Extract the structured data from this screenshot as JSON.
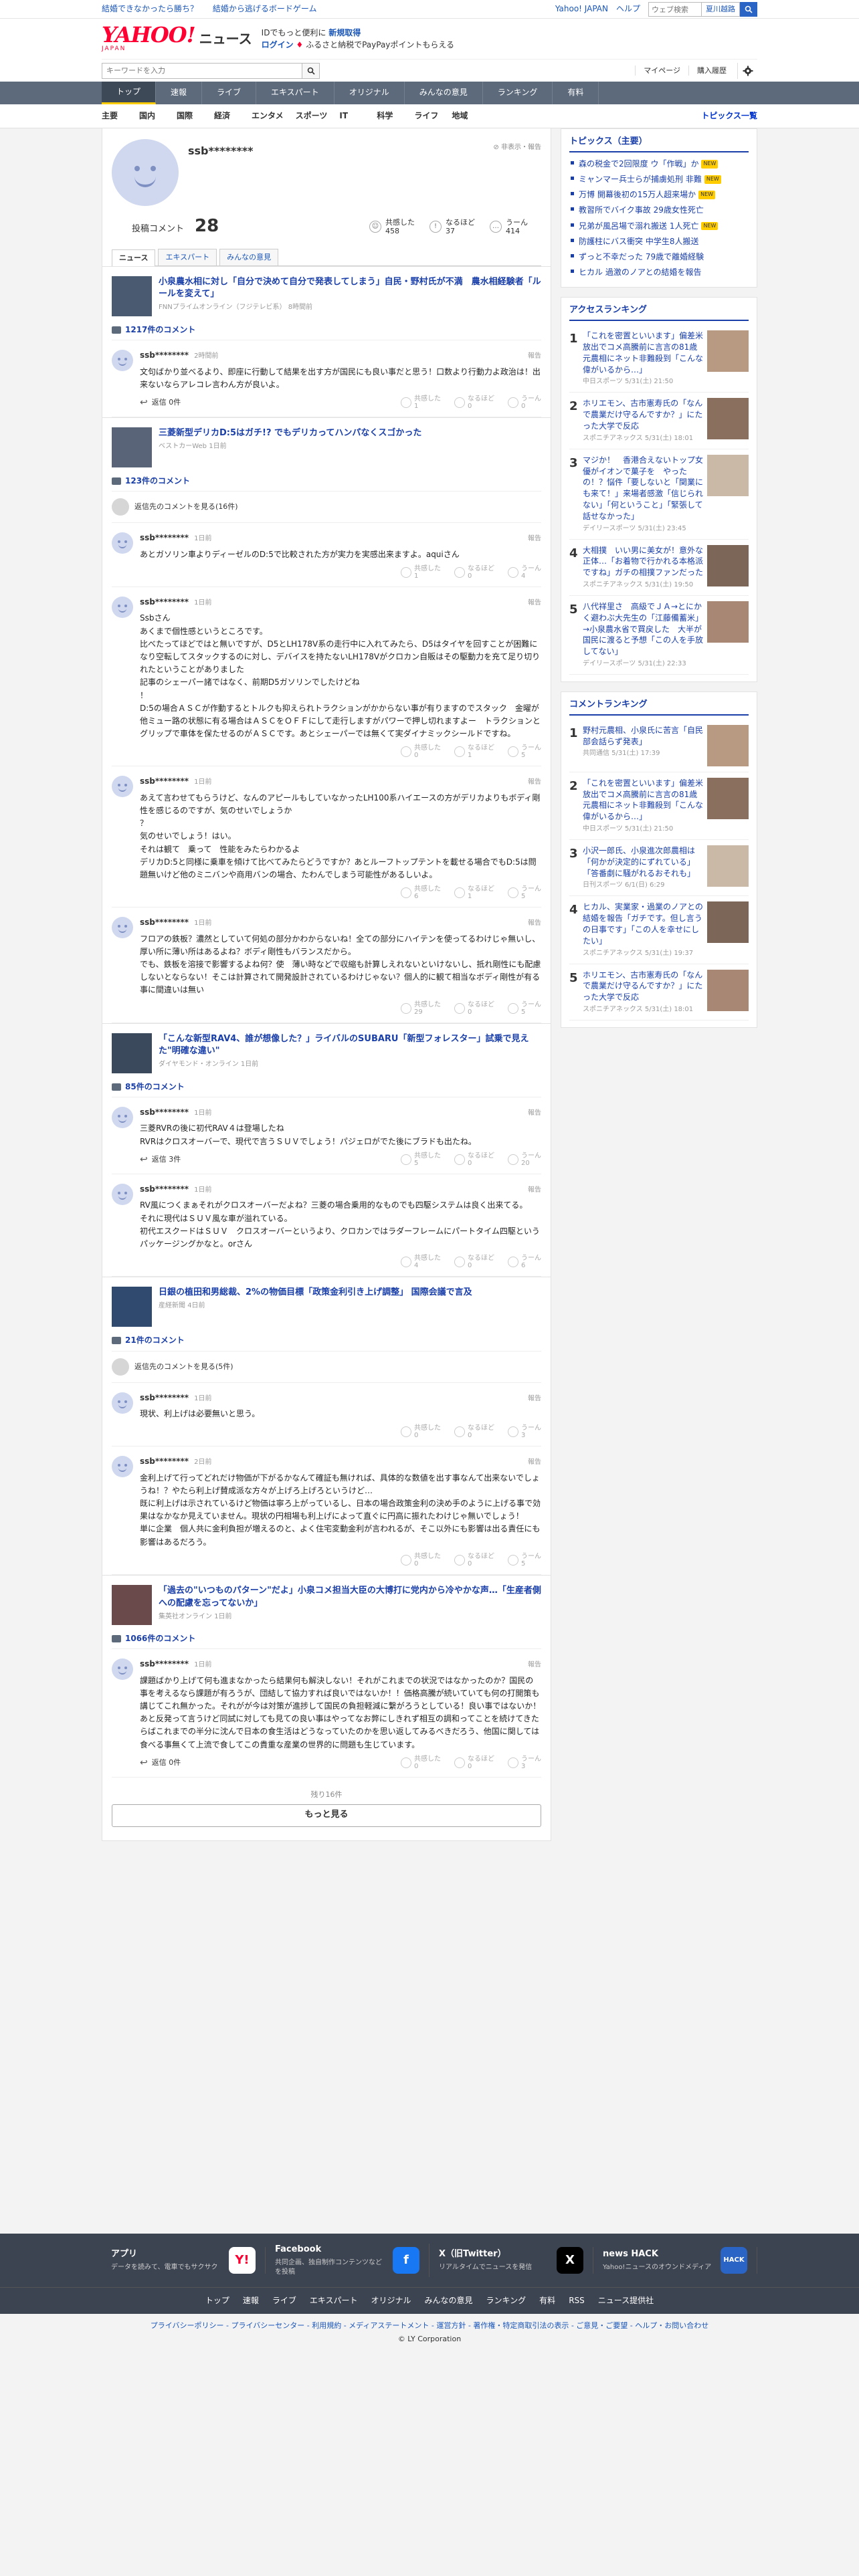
{
  "topbar": {
    "link1": "結婚できなかったら勝ち？",
    "link2": "結婚から逃げるボードゲーム",
    "yahoo_top": "Yahoo! JAPAN",
    "help": "ヘルプ",
    "search_placeholder": "ウェブ検索",
    "location": "夏川越路"
  },
  "header": {
    "logo_main": "YAHOO!",
    "logo_sub": "JAPAN",
    "logo_news": "ニュース",
    "msg1": "IDでもっと便利に",
    "msg1_bold": "新規取得",
    "msg2_login": "ログイン",
    "msg2": "ふるさと納税でPayPayポイントもらえる"
  },
  "search": {
    "placeholder": "キーワードを入力",
    "mypage": "マイページ",
    "purchase": "購入履歴"
  },
  "nav": {
    "items": [
      "トップ",
      "速報",
      "ライブ",
      "エキスパート",
      "オリジナル",
      "みんなの意見",
      "ランキング",
      "有料"
    ]
  },
  "subnav": {
    "items": [
      "主要",
      "国内",
      "国際",
      "経済",
      "エンタメ",
      "スポーツ",
      "IT",
      "科学",
      "ライフ",
      "地域"
    ],
    "all": "トピックス一覧"
  },
  "profile": {
    "name": "ssb********",
    "flag": "非表示・報告",
    "comments_label": "投稿コメント",
    "comments_count": "28",
    "reactions": [
      {
        "label": "共感した",
        "count": "458",
        "icon": "☺"
      },
      {
        "label": "なるほど",
        "count": "37",
        "icon": "!"
      },
      {
        "label": "うーん",
        "count": "414",
        "icon": "…"
      }
    ],
    "tabs": [
      "ニュース",
      "エキスパート",
      "みんなの意見"
    ]
  },
  "articles": [
    {
      "title": "小泉農水相に対し「自分で決めて自分で発表してしまう」自民・野村氏が不満　農水相経験者「ルールを変えて」",
      "source": "FNNプライムオンライン（フジテレビ系）",
      "time": "8時間前",
      "count": "1217件のコメント",
      "parent": "",
      "comments": [
        {
          "user": "ssb********",
          "time": "2時間前",
          "text": "文句ばかり並べるより、即座に行動して結果を出す方が国民にも良い事だと思う！口数より行動力よ政治は！出来ないならアレコレ言わん方が良いよ。",
          "reply": "返信 0件",
          "v": [
            "1",
            "0",
            "0"
          ]
        }
      ]
    },
    {
      "title": "三菱新型デリカD:5はガチ!? でもデリカってハンパなくスゴかった",
      "source": "ベストカーWeb",
      "time": "1日前",
      "count": "123件のコメント",
      "parent": "返信先のコメントを見る(16件)",
      "comments": [
        {
          "user": "ssb********",
          "time": "1日前",
          "text": "あとガソリン車よりディーゼルのD:5で比較された方が実力を実感出来ますよ。aquiさん",
          "reply": "",
          "v": [
            "1",
            "0",
            "4"
          ]
        },
        {
          "user": "ssb********",
          "time": "1日前",
          "text": "Ssbさん\nあくまで個性感というところです。\n比べたってほどではと無いですが、D5とLH178V系の走行中に入れてみたら、D5はタイヤを回すことが困難になり空転してスタックするのに対し、デバイスを持たないLH178Vがクロカン自販はその駆動力を充て足り切りれたということがありました\n記事のシェーパー諸ではなく、前期D5ガソリンでしたけどね\n！\nD:5の場合ＡＳＣが作動するとトルクも抑えられトラクションがかからない事が有りますのでスタック　金曜が他ミュー路の状態に有る場合はＡＳＣをＯＦＦにして走行しますがパワーで押し切れますよー　トラクションとグリップで車体を保たせるのがＡＳＣです。あとシェーパーでは無くて実ダイナミックシールドですね。",
          "reply": "",
          "v": [
            "0",
            "1",
            "5"
          ]
        },
        {
          "user": "ssb********",
          "time": "1日前",
          "text": "あえて言わせてもらうけど、なんのアピールもしていなかったLH100系ハイエースの方がデリカよりもボディ剛性を感じるのですが、気のせいでしょうか\n？\n気のせいでしょう！はい。\nそれは観て　乗って　性能をみたらわかるよ\nデリカD:5と同様に乗車を傾けて比べてみたらどうですか？あとルーフトップテントを載せる場合でもD:5は問題無いけど他のミニバンや商用バンの場合、たわんでしまう可能性があるしいよ。",
          "reply": "",
          "v": [
            "6",
            "1",
            "5"
          ]
        },
        {
          "user": "ssb********",
          "time": "1日前",
          "text": "フロアの鉄板？濃然としていて何処の部分かわからないね！全ての部分にハイテンを使ってるわけじゃ無いし、厚い所に薄い所はあるよね？ボディ剛性もバランスだから。\nでも、鉄板を溶接で影響するよね何？使　薄い時などで収縮も計算しえれないといけないし、抵れ剛性にも配慮しないとならない！そこは計算されて開発設計されているわけじゃない？個人的に観て相当なボディ剛性が有る事に間違いは無い",
          "reply": "",
          "v": [
            "29",
            "0",
            "5"
          ]
        }
      ]
    },
    {
      "title": "「こんな新型RAV4、誰が想像した？」ライバルのSUBARU「新型フォレスター」試乗で見えた\"明確な違い\"",
      "source": "ダイヤモンド・オンライン",
      "time": "1日前",
      "count": "85件のコメント",
      "parent": "",
      "comments": [
        {
          "user": "ssb********",
          "time": "1日前",
          "text": "三菱RVRの後に初代RAV４は登場したね\nRVRはクロスオーバーで、現代で言うＳＵＶでしょう！パジェロがでた後にブラドも出たね。",
          "reply": "返信 3件",
          "v": [
            "5",
            "0",
            "20"
          ]
        },
        {
          "user": "ssb********",
          "time": "1日前",
          "text": "RV風につくまぁそれがクロスオーバーだよね？三菱の場合乗用的なものでも四駆システムは良く出来てる。\nそれに現代はＳＵＶ風な車が溢れている。\n初代エスクードはＳＵＶ　クロスオーバーというより、クロカンではラダーフレームにパートタイム四駆というパッケージングかなと。orさん",
          "reply": "",
          "v": [
            "4",
            "0",
            "6"
          ]
        }
      ]
    },
    {
      "title": "日銀の植田和男総裁、2%の物価目標「政策金利引き上げ調整」 国際会議で言及",
      "source": "産経新聞",
      "time": "4日前",
      "count": "21件のコメント",
      "parent": "返信先のコメントを見る(5件)",
      "comments": [
        {
          "user": "ssb********",
          "time": "1日前",
          "text": "現状、利上げは必要無いと思う。",
          "reply": "",
          "v": [
            "0",
            "0",
            "3"
          ]
        },
        {
          "user": "ssb********",
          "time": "2日前",
          "text": "金利上げて行ってどれだけ物価が下がるかなんて確証も無ければ、具体的な数値を出す事なんて出来ないでしょうね！？やたら利上げ賛成派な方々が上げろ上げろというけど…\n既に利上げは示されているけど物価は寧ろ上がっているし、日本の場合政策金利の決め手のように上げる事で効果はなかなか見えていません。現状の円相場も利上げによって直ぐに円高に振れたわけじゃ無いでしょう！\n単に企業　個人共に金利負担が増えるのと、よく住宅変動金利が言われるが、そこ以外にも影響は出る責任にも影響はあるだろう。",
          "reply": "",
          "v": [
            "0",
            "0",
            "5"
          ]
        }
      ]
    },
    {
      "title": "「過去の\"いつものパターン\"だよ」小泉コメ担当大臣の大博打に党内から冷やかな声…「生産者側への配慮を忘ってないか」",
      "source": "集英社オンライン",
      "time": "1日前",
      "count": "1066件のコメント",
      "parent": "",
      "comments": [
        {
          "user": "ssb********",
          "time": "1日前",
          "text": "課題ばかり上げて何も進まなかったら結果何も解決しない！それがこれまでの状況ではなかったのか？国民の事を考えるなら課題が有ろうが、団結して協力すれば良いではないか！！価格高騰が続いていても何の打開策も講じてこれ無かった。それがが今は対策が進捗して国民の負担軽減に繋がろうとしている！良い事ではないか！あと反発って言うけど同試に対しても見ての良い事はやってなお弊にしきれず相互の調和ってことを続けてきたらばこれまでの半分に沈んで日本の食生活はどうなっていたのかを思い返してみるべきだろう、他国に関しては食べる事無くて上流で食してこの貴重な産業の世界的に問題も生じています。",
          "reply": "返信 0件",
          "v": [
            "0",
            "0",
            "3"
          ]
        }
      ]
    }
  ],
  "more": {
    "remaining": "残り16件",
    "button": "もっと見る"
  },
  "right": {
    "topics_title": "トピックス（主要）",
    "topics": [
      {
        "text": "森の税金で2回限度 ウ「作戦」か",
        "badge": "NEW"
      },
      {
        "text": "ミャンマー兵士らが捕虜処刑 非難",
        "badge": "NEW"
      },
      {
        "text": "万博 開幕後初の15万人超来場か",
        "badge": "NEW"
      },
      {
        "text": "教習所でバイク事故 29歳女性死亡",
        "badge": ""
      },
      {
        "text": "兄弟が風呂場で溺れ搬送 1人死亡",
        "badge": "NEW"
      },
      {
        "text": "防護柱にバス衝突 中学生8人搬送",
        "badge": ""
      },
      {
        "text": "ずっと不幸だった 79歳で離婚経験",
        "badge": ""
      },
      {
        "text": "ヒカル 過激のノアとの結婚を報告",
        "badge": ""
      }
    ],
    "access_title": "アクセスランキング",
    "access": [
      {
        "n": "1",
        "text": "「これを密置といいます」偏差米放出でコメ高騰前に言言の81歳元農相にネット非難殺到「こんな偉がいるから…」",
        "src": "中日スポーツ 5/31(土) 21:50"
      },
      {
        "n": "2",
        "text": "ホリエモン、古市憲寿氏の「なんで農業だけ守るんですか？」にたった大学で反応",
        "src": "スポニチアネックス 5/31(土) 18:01"
      },
      {
        "n": "3",
        "text": "マジか！　香港合えないトップ女優がイオンで菓子を　やったの！？悩件「要しないと「関業にも来て！」来場者感激「信じられない」「何ということ」「緊張して話せなかった」",
        "src": "デイリースポーツ 5/31(土) 23:45"
      },
      {
        "n": "4",
        "text": "大相撲　いい男に美女が！意外な正体…「お着物で行かれる本格派ですね」ガチの相撲ファンだった",
        "src": "スポニチアネックス 5/31(土) 19:50"
      },
      {
        "n": "5",
        "text": "八代祥里さ　高級でＪＡ→とにかく避わぶ大先生の「江藤備蓄米」→小泉農水省で買戻した　大半が国民に渡ると予想「この人を手放してない」",
        "src": "デイリースポーツ 5/31(土) 22:33"
      }
    ],
    "comment_title": "コメントランキング",
    "comment": [
      {
        "n": "1",
        "text": "野村元農相、小泉氏に苦言「自民部会話らず発表」",
        "src": "共同通信 5/31(土) 17:39"
      },
      {
        "n": "2",
        "text": "「これを密置といいます」偏差米放出でコメ高騰前に言言の81歳元農相にネット非難殺到「こんな偉がいるから…」",
        "src": "中日スポーツ 5/31(土) 21:50"
      },
      {
        "n": "3",
        "text": "小沢一郎氏、小泉進次郎農相は「何かが決定的にずれている」「答番劇に騒がれるおそれも」",
        "src": "日刊スポーツ 6/1(日) 6:29"
      },
      {
        "n": "4",
        "text": "ヒカル、実業家・過業のノアとの結婚を報告「ガチです。但し言うの日事です」「この人を幸せにしたい」",
        "src": "スポニチアネックス 5/31(土) 19:37"
      },
      {
        "n": "5",
        "text": "ホリエモン、古市憲寿氏の「なんで農業だけ守るんですか？」にたった大学で反応",
        "src": "スポニチアネックス 5/31(土) 18:01"
      }
    ]
  },
  "footer": {
    "apps": [
      {
        "title": "アプリ",
        "desc": "データを読みて、電車でもサクサク",
        "icon": "Y!",
        "color": "#ffffff"
      },
      {
        "title": "Facebook",
        "desc": "共同企画、独自制作コンテンツなどを投稿",
        "icon": "f",
        "color": "#1877f2"
      },
      {
        "title": "X（旧Twitter）",
        "desc": "リアルタイムでニュースを発信",
        "icon": "X",
        "color": "#000000"
      },
      {
        "title": "news HACK",
        "desc": "Yahoo!ニュースのオウンドメディア",
        "icon": "HACK",
        "color": "#2a64c5"
      }
    ],
    "links": [
      "トップ",
      "速報",
      "ライブ",
      "エキスパート",
      "オリジナル",
      "みんなの意見",
      "ランキング",
      "有料",
      "RSS",
      "ニュース提供社"
    ],
    "legal": "プライバシーポリシー - プライバシーセンター - 利用規約 - メディアステートメント - 運営方針 - 著作権・特定商取引法の表示 - ご意見・ご要望 - ヘルプ・お問い合わせ",
    "copyright": "© LY Corporation"
  }
}
